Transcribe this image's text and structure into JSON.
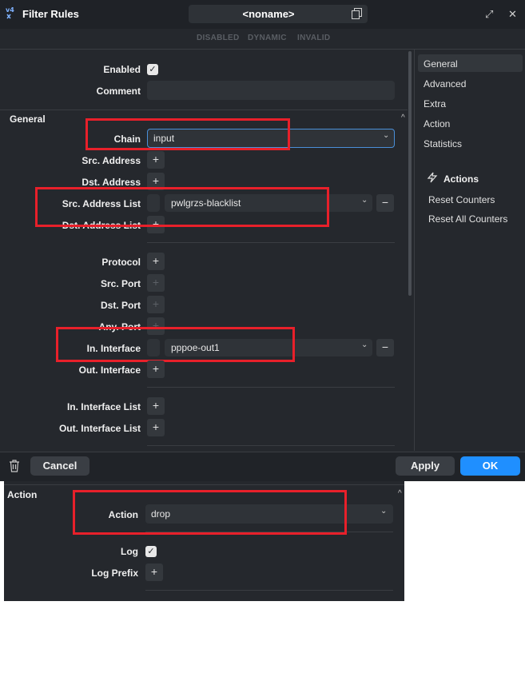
{
  "window": {
    "title": "Filter Rules",
    "name": "<noname>",
    "flags": [
      "DISABLED",
      "DYNAMIC",
      "INVALID"
    ]
  },
  "fields": {
    "enabled_label": "Enabled",
    "comment_label": "Comment",
    "general_section": "General",
    "chain_label": "Chain",
    "chain_value": "input",
    "src_address_label": "Src. Address",
    "dst_address_label": "Dst. Address",
    "src_address_list_label": "Src. Address List",
    "src_address_list_value": "pwlgrzs-blacklist",
    "dst_address_list_label": "Dst. Address List",
    "protocol_label": "Protocol",
    "src_port_label": "Src. Port",
    "dst_port_label": "Dst. Port",
    "any_port_label": "Any. Port",
    "in_interface_label": "In. Interface",
    "in_interface_value": "pppoe-out1",
    "out_interface_label": "Out. Interface",
    "in_interface_list_label": "In. Interface List",
    "out_interface_list_label": "Out. Interface List"
  },
  "sidebar": {
    "items": [
      "General",
      "Advanced",
      "Extra",
      "Action",
      "Statistics"
    ],
    "actions_title": "Actions",
    "actions": [
      "Reset Counters",
      "Reset All Counters"
    ]
  },
  "footer": {
    "cancel": "Cancel",
    "apply": "Apply",
    "ok": "OK"
  },
  "action_panel": {
    "section": "Action",
    "action_label": "Action",
    "action_value": "drop",
    "log_label": "Log",
    "log_prefix_label": "Log Prefix"
  },
  "icons": {
    "plus": "+",
    "minus": "−",
    "chevron_down": "⌄",
    "chevron_up": "^",
    "check": "✓",
    "bolt": "⚡",
    "trash": "🗑",
    "restore": "⤢",
    "close": "✕"
  },
  "colors": {
    "ok_button": "#1f8fff",
    "highlight_box": "#e8202a"
  }
}
